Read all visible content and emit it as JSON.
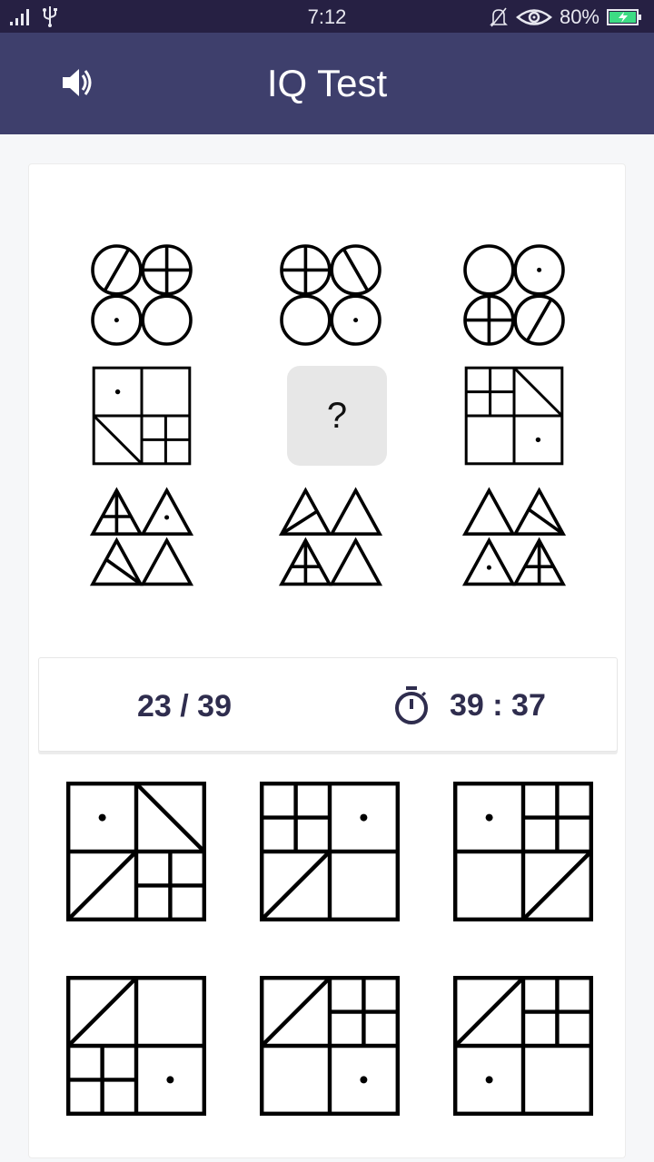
{
  "status_bar": {
    "time": "7:12",
    "battery": "80%",
    "icons": [
      "signal-icon",
      "usb-icon",
      "bell-muted-icon",
      "eye-icon",
      "battery-charging-icon"
    ]
  },
  "app_bar": {
    "title": "IQ Test",
    "sound_icon": "speaker-icon"
  },
  "colors": {
    "status_bar": "#262043",
    "app_bar": "#3e3f6c",
    "text_dark": "#2f2d4e",
    "placeholder_bg": "#e7e7e7"
  },
  "puzzle": {
    "missing_label": "?",
    "rows": [
      {
        "shape": "circle",
        "cells": [
          [
            "slash",
            "cross",
            "dot",
            "empty"
          ],
          [
            "cross",
            "backslash",
            "empty",
            "dot"
          ],
          [
            "empty",
            "dot",
            "cross",
            "slash"
          ]
        ]
      },
      {
        "shape": "square",
        "cells": [
          [
            "dot",
            "empty",
            "backslash",
            "cross"
          ],
          null,
          [
            "cross",
            "backslash",
            "empty",
            "dot"
          ]
        ]
      },
      {
        "shape": "triangle",
        "cells": [
          [
            "cross",
            "dot",
            "line",
            "empty"
          ],
          [
            "line",
            "empty",
            "cross",
            "empty"
          ],
          [
            "empty",
            "line",
            "dot",
            "cross"
          ]
        ]
      }
    ]
  },
  "info": {
    "progress": "23 / 39",
    "timer": "39 : 37",
    "timer_icon": "stopwatch-icon"
  },
  "options": [
    {
      "shape": "square",
      "cells": [
        "dot",
        "backslash",
        "slash",
        "cross"
      ]
    },
    {
      "shape": "square",
      "cells": [
        "cross",
        "dot",
        "slash",
        "empty"
      ]
    },
    {
      "shape": "square",
      "cells": [
        "dot",
        "cross",
        "empty",
        "slash"
      ]
    },
    {
      "shape": "square",
      "cells": [
        "slash",
        "empty",
        "cross",
        "dot"
      ]
    },
    {
      "shape": "square",
      "cells": [
        "slash",
        "cross",
        "empty",
        "dot"
      ]
    },
    {
      "shape": "square",
      "cells": [
        "slash",
        "cross",
        "dot",
        "empty"
      ]
    }
  ]
}
